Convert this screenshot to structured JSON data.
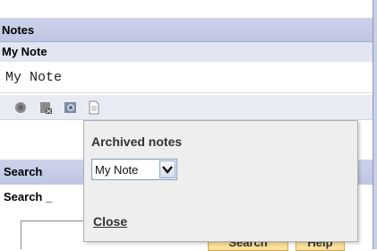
{
  "notes_panel": {
    "header": "Notes",
    "note_title": "My Note",
    "note_value": "My Note"
  },
  "toolbar": {
    "icons": [
      "save-icon",
      "delete-icon",
      "archive-icon",
      "new-note-icon"
    ]
  },
  "popup": {
    "title": "Archived notes",
    "select_value": "My Note",
    "close_label": "Close"
  },
  "search_panel": {
    "header": "Search",
    "label": "Search _",
    "search_button": "Search",
    "help_button": "Help"
  },
  "colors": {
    "header_bg": "#c9cfe6",
    "button_bg": "#fbdf9b",
    "popup_bg": "#eeeeee"
  }
}
